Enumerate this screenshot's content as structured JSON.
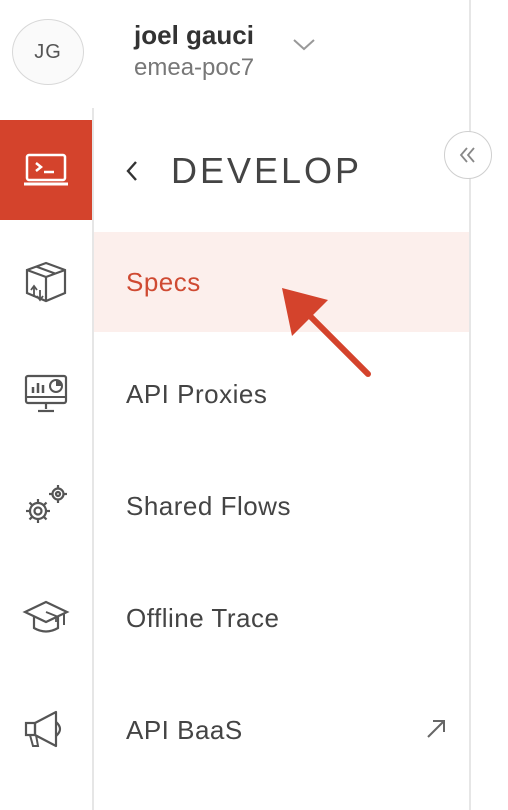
{
  "user": {
    "initials": "JG",
    "name": "joel gauci",
    "org": "emea-poc7"
  },
  "colors": {
    "accent": "#d4432c",
    "active_bg": "#fcefec",
    "active_text": "#cf4a32"
  },
  "rail": {
    "items": [
      {
        "icon": "terminal-icon",
        "active": true
      },
      {
        "icon": "package-icon",
        "active": false
      },
      {
        "icon": "analytics-monitor-icon",
        "active": false
      },
      {
        "icon": "gears-icon",
        "active": false
      },
      {
        "icon": "graduation-cap-icon",
        "active": false
      },
      {
        "icon": "megaphone-icon",
        "active": false
      }
    ]
  },
  "panel": {
    "title": "DEVELOP",
    "items": [
      {
        "label": "Specs",
        "active": true
      },
      {
        "label": "API Proxies",
        "active": false
      },
      {
        "label": "Shared Flows",
        "active": false
      },
      {
        "label": "Offline Trace",
        "active": false
      },
      {
        "label": "API BaaS",
        "active": false,
        "external": true
      }
    ]
  }
}
